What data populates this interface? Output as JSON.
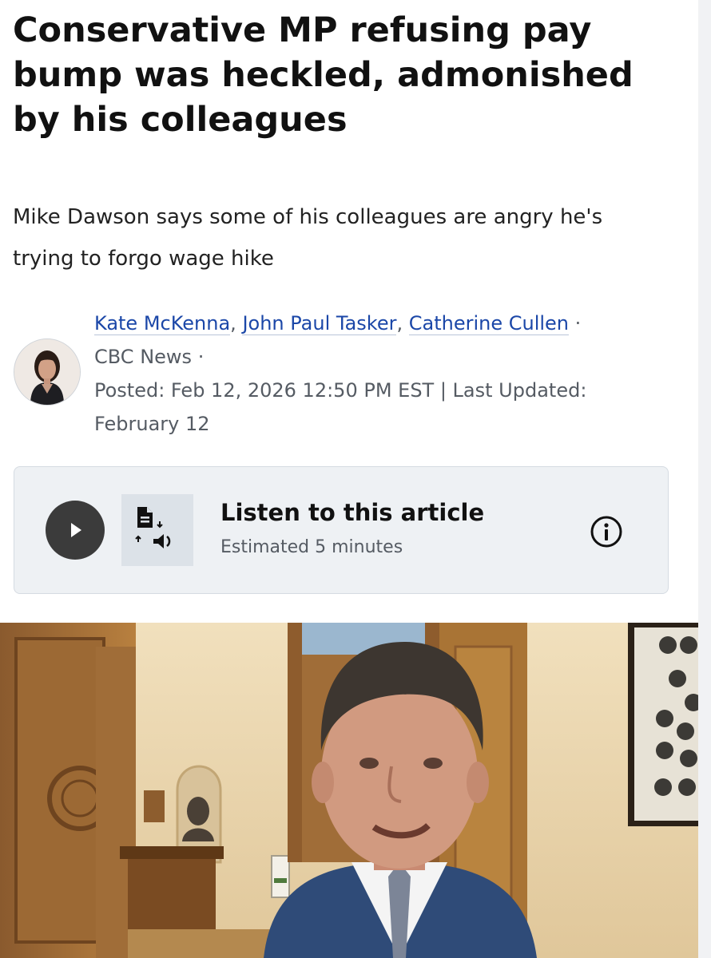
{
  "article": {
    "headline": "Conservative MP refusing pay bump was heckled, admonished by his colleagues",
    "deck": "Mike Dawson says some of his colleagues are angry he's trying to forgo wage hike"
  },
  "byline": {
    "authors": [
      "Kate McKenna",
      "John Paul Tasker",
      "Catherine Cullen"
    ],
    "comma": ",",
    "dot": "·",
    "outlet": "CBC News",
    "posted": "Posted: Feb 12, 2026 12:50 PM EST | Last Updated: February 12"
  },
  "listen": {
    "title": "Listen to this article",
    "subtitle": "Estimated 5 minutes"
  },
  "icons": {
    "play": "play-icon",
    "tts": "text-to-speech-icon",
    "info": "info-icon"
  },
  "colors": {
    "author_link": "#1b47a8",
    "listen_card_bg": "#eef1f4",
    "play_button": "#3b3b3b"
  }
}
